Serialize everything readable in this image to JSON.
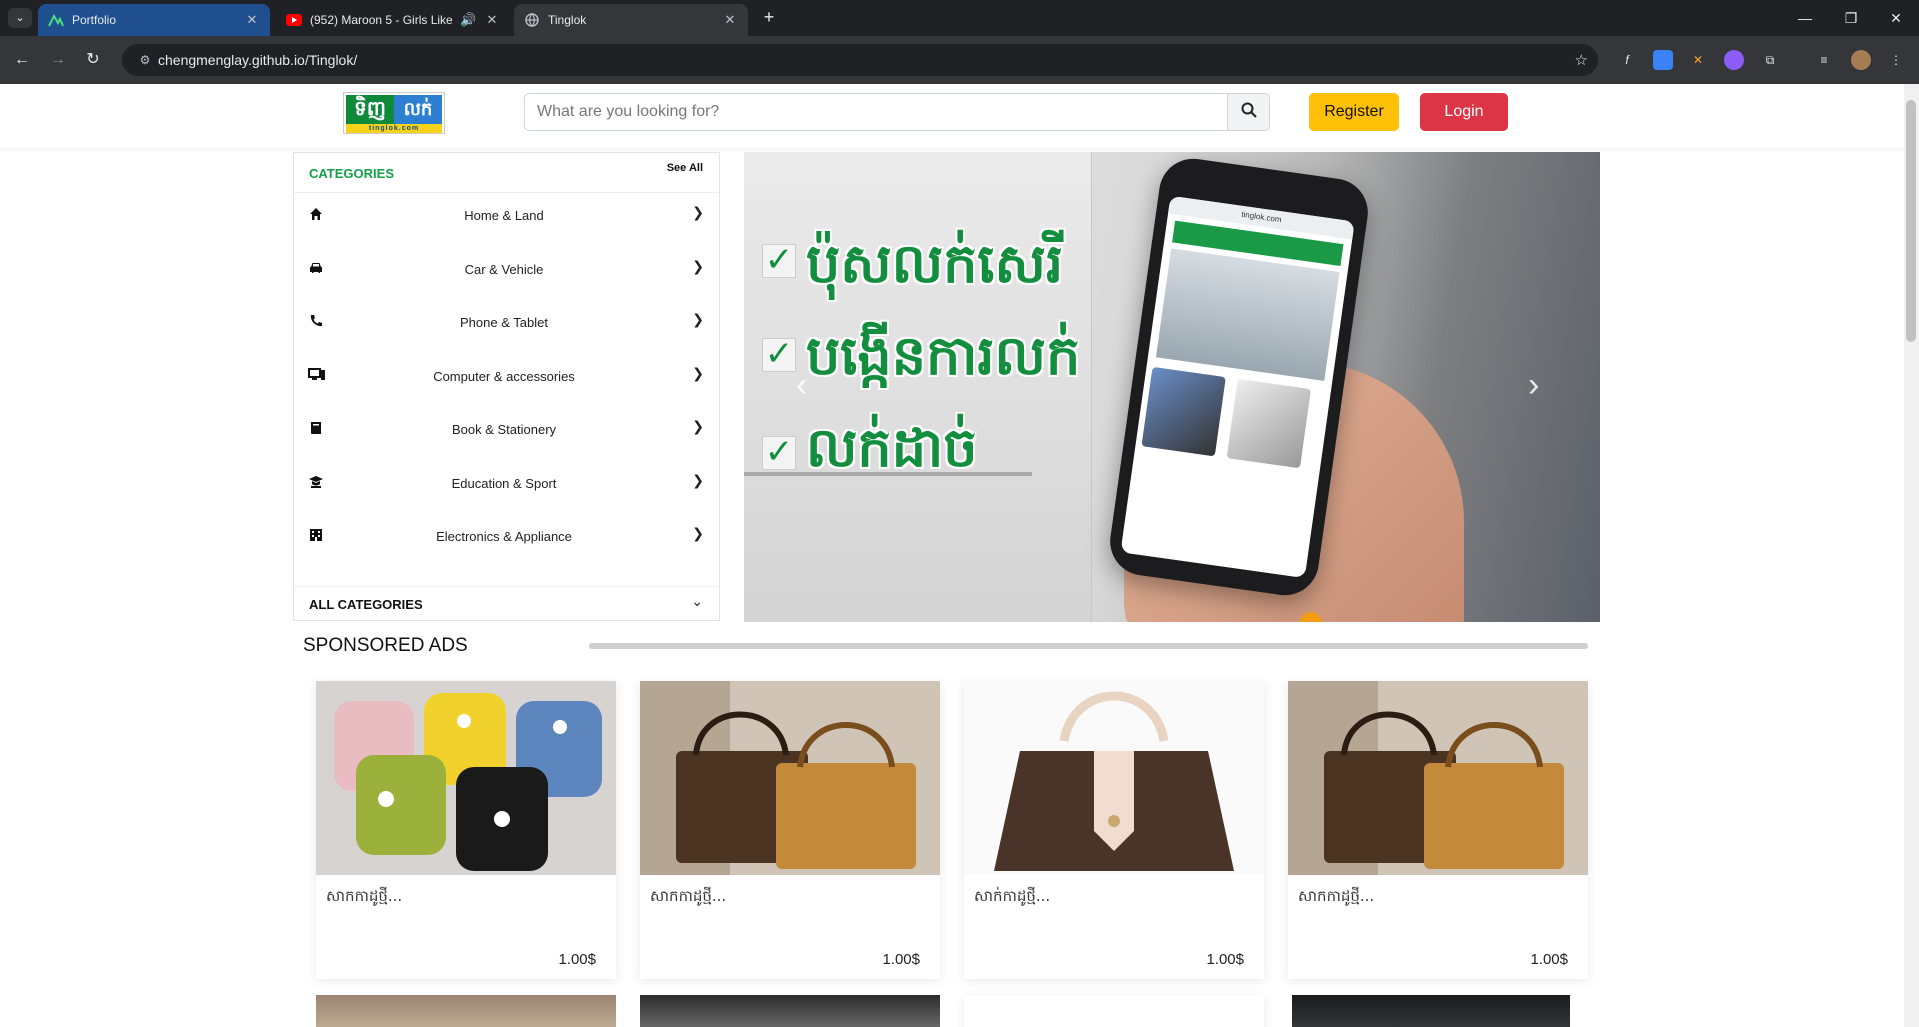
{
  "browser": {
    "tabs": [
      {
        "title": "Portfolio",
        "icon": "portfolio-logo-icon"
      },
      {
        "title": "(952) Maroon 5 - Girls Like",
        "icon": "youtube-icon"
      },
      {
        "title": "Tinglok",
        "icon": "globe-icon"
      }
    ],
    "url": "chengmenglay.github.io/Tinglok/"
  },
  "site": {
    "logo_text_left": "ទិញ",
    "logo_text_right": "លក់",
    "logo_domain": "tinglok.com",
    "search_placeholder": "What are you looking for?",
    "register_label": "Register",
    "login_label": "Login"
  },
  "categories": {
    "title": "CATEGORIES",
    "see_all": "See All",
    "items": [
      {
        "label": "Home & Land",
        "icon": "home-icon"
      },
      {
        "label": "Car & Vehicle",
        "icon": "car-icon"
      },
      {
        "label": "Phone & Tablet",
        "icon": "phone-icon"
      },
      {
        "label": "Computer & accessories",
        "icon": "computer-icon"
      },
      {
        "label": "Book & Stationery",
        "icon": "book-icon"
      },
      {
        "label": "Education & Sport",
        "icon": "graduation-icon"
      },
      {
        "label": "Electronics & Appliance",
        "icon": "building-icon"
      }
    ],
    "all_label": "ALL CATEGORIES"
  },
  "banner": {
    "lines": [
      "ប៉ុសលក់សេរី",
      "បង្កើនការលក់",
      "លក់ដាច់"
    ],
    "phone_site": "tinglok.com"
  },
  "sponsored": {
    "title": "SPONSORED ADS",
    "cards": [
      {
        "name": "សាកកាដូថ្មី...",
        "price": "1.00$"
      },
      {
        "name": "សាកកាដូថ្មី...",
        "price": "1.00$"
      },
      {
        "name": "សាក់កាដូថ្មី...",
        "price": "1.00$"
      },
      {
        "name": "សាកកាដូថ្មី...",
        "price": "1.00$"
      }
    ]
  },
  "colors": {
    "brand_green": "#14a04a",
    "register": "#ffc107",
    "login": "#dc3545"
  }
}
